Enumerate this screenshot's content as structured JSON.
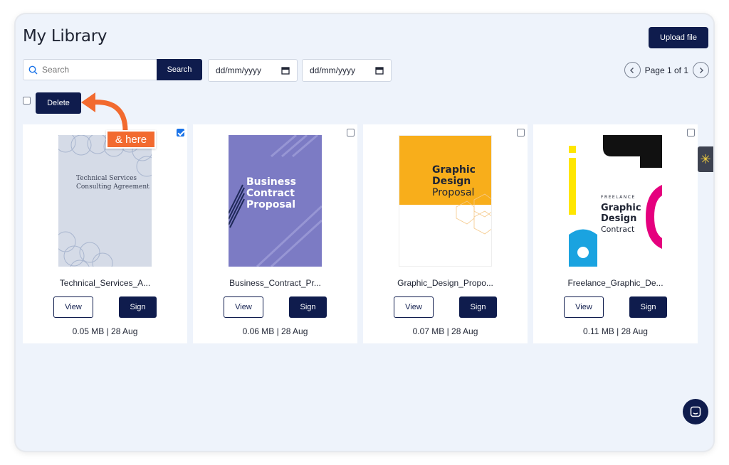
{
  "header": {
    "title": "My Library",
    "upload_label": "Upload file"
  },
  "search": {
    "placeholder": "Search",
    "button_label": "Search"
  },
  "date_filters": [
    {
      "placeholder": "dd/mm/yyyy"
    },
    {
      "placeholder": "dd/mm/yyyy"
    }
  ],
  "pagination": {
    "label": "Page 1 of 1"
  },
  "bulk": {
    "delete_label": "Delete"
  },
  "callout": {
    "text": "& here"
  },
  "cards": [
    {
      "name": "Technical_Services_A...",
      "meta": "0.05 MB | 28 Aug",
      "checked": true,
      "view_label": "View",
      "sign_label": "Sign",
      "thumb_lines": [
        "Technical Services",
        "Consulting Agreement"
      ]
    },
    {
      "name": "Business_Contract_Pr...",
      "meta": "0.06 MB | 28 Aug",
      "checked": false,
      "view_label": "View",
      "sign_label": "Sign",
      "thumb_lines": [
        "Business",
        "Contract",
        "Proposal"
      ]
    },
    {
      "name": "Graphic_Design_Propo...",
      "meta": "0.07 MB | 28 Aug",
      "checked": false,
      "view_label": "View",
      "sign_label": "Sign",
      "thumb_lines": [
        "Graphic",
        "Design",
        "Proposal"
      ]
    },
    {
      "name": "Freelance_Graphic_De...",
      "meta": "0.11 MB | 28 Aug",
      "checked": false,
      "view_label": "View",
      "sign_label": "Sign",
      "thumb_lines": [
        "FREELANCE",
        "Graphic",
        "Design",
        "Contract"
      ]
    }
  ],
  "colors": {
    "primary": "#0f1c4d",
    "accent": "#f26a2f",
    "background": "#eef3fb"
  },
  "icons": {
    "search": "search-icon",
    "calendar": "calendar-icon",
    "prev": "chevron-left-icon",
    "next": "chevron-right-icon",
    "chat": "chat-icon",
    "side": "asterisk-icon"
  }
}
